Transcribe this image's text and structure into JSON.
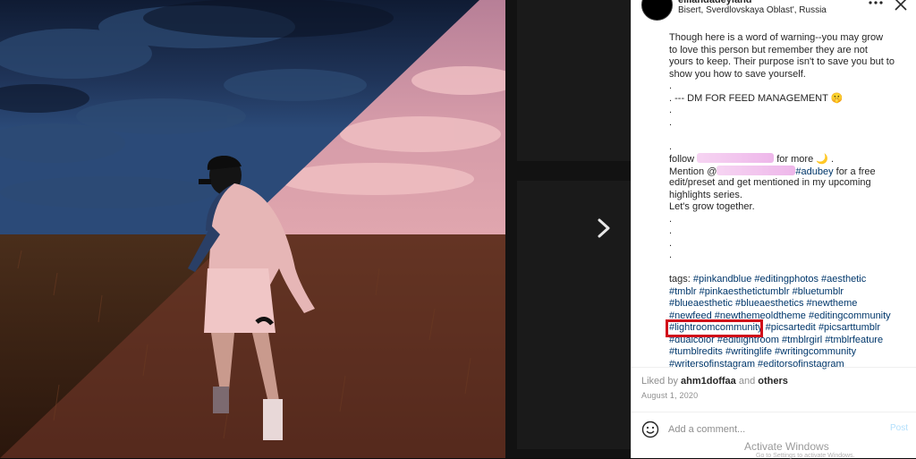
{
  "post": {
    "account_name": "elliandadeyland",
    "location": "Bisert, Sverdlovskaya Oblast', Russia"
  },
  "caption": {
    "para1": [
      "Though here is a word of warning--you may grow",
      "to love this person but remember they are not",
      "yours to keep. Their purpose isn't to save you but to",
      "show you how to save yourself."
    ],
    "dot": ".",
    "dm_line": ". --- DM FOR FEED MANAGEMENT 🤫",
    "follow_prefix": "follow ",
    "follow_suffix": " for more 🌙 .",
    "mention_prefix": "Mention @",
    "mention_tag": "#adubey",
    "mention_suffix": " for a free",
    "mention_lines": [
      "edit/preset and get mentioned in my upcoming",
      "highlights series.",
      "Let's grow together."
    ],
    "tags_label": "tags: ",
    "tag_lines": [
      [
        "#pinkandblue",
        "#editingphotos",
        "#aesthetic"
      ],
      [
        "#tmblr",
        "#pinkaesthetictumblr",
        "#bluetumblr"
      ],
      [
        "#blueaesthetic",
        "#blueaesthetics",
        "#newtheme"
      ],
      [
        "#newfeed",
        "#newthemeoldtheme",
        "#editingcommunity"
      ],
      [
        "#lightroomcommunity",
        "#picsartedit",
        "#picsarttumblr"
      ],
      [
        "#dualcolor",
        "#editlightroom",
        "#tmblrgirl",
        "#tmblrfeature"
      ],
      [
        "#tumblredits",
        "#writinglife",
        "#writingcommunity"
      ],
      [
        "#writersofinstagram",
        "#editorsofinstagram"
      ]
    ]
  },
  "likes": {
    "prefix": "Liked by ",
    "user": "ahm1doffaa",
    "middle": " and ",
    "others": "others"
  },
  "date": "August 1, 2020",
  "comment": {
    "placeholder": "Add a comment...",
    "post_label": "Post"
  },
  "watermark": {
    "title": "Activate Windows",
    "subtitle": "Go to Settings to activate Windows."
  },
  "colors": {
    "highlight": "#d10f1a",
    "hashtag": "#00376b",
    "post_button": "#b2dffc"
  },
  "icons": [
    "more-icon",
    "close-icon",
    "chevron-right-icon",
    "smiley-icon"
  ]
}
